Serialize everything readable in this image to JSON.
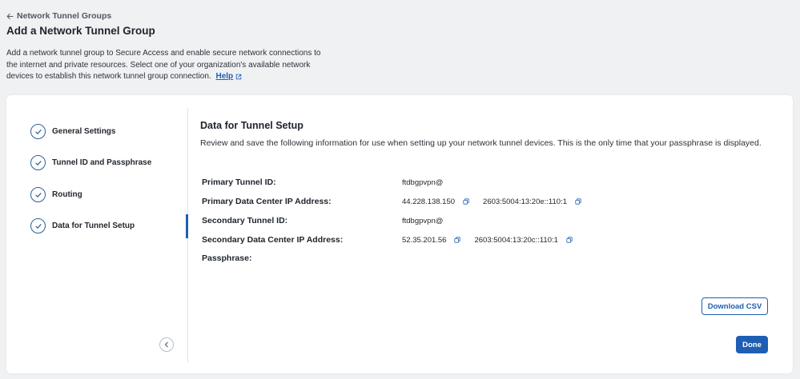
{
  "header": {
    "back_label": "Network Tunnel Groups",
    "title": "Add a Network Tunnel Group",
    "description": "Add a network tunnel group to Secure Access and enable secure network connections to the internet and private resources. Select one of your organization's available network devices to establish this network tunnel group connection.",
    "help_label": "Help"
  },
  "steps": [
    {
      "label": "General Settings"
    },
    {
      "label": "Tunnel ID and Passphrase"
    },
    {
      "label": "Routing"
    },
    {
      "label": "Data for Tunnel Setup"
    }
  ],
  "content": {
    "title": "Data for Tunnel Setup",
    "description": "Review and save the following information for use when setting up your network tunnel devices. This is the only time that your passphrase is displayed.",
    "rows": [
      {
        "label": "Primary Tunnel ID:",
        "value": "ftdbgpvpn@"
      },
      {
        "label": "Primary Data Center IP Address:",
        "ip1": "44.228.138.150",
        "ip2": "2603:5004:13:20e::110:1"
      },
      {
        "label": "Secondary Tunnel ID:",
        "value": "ftdbgpvpn@"
      },
      {
        "label": "Secondary Data Center IP Address:",
        "ip1": "52.35.201.56",
        "ip2": "2603:5004:13:20c::110:1"
      },
      {
        "label": "Passphrase:",
        "value": ""
      }
    ]
  },
  "buttons": {
    "download_csv": "Download CSV",
    "done": "Done"
  },
  "colors": {
    "accent": "#1e5fb4",
    "step_check": "#2f5f91"
  }
}
